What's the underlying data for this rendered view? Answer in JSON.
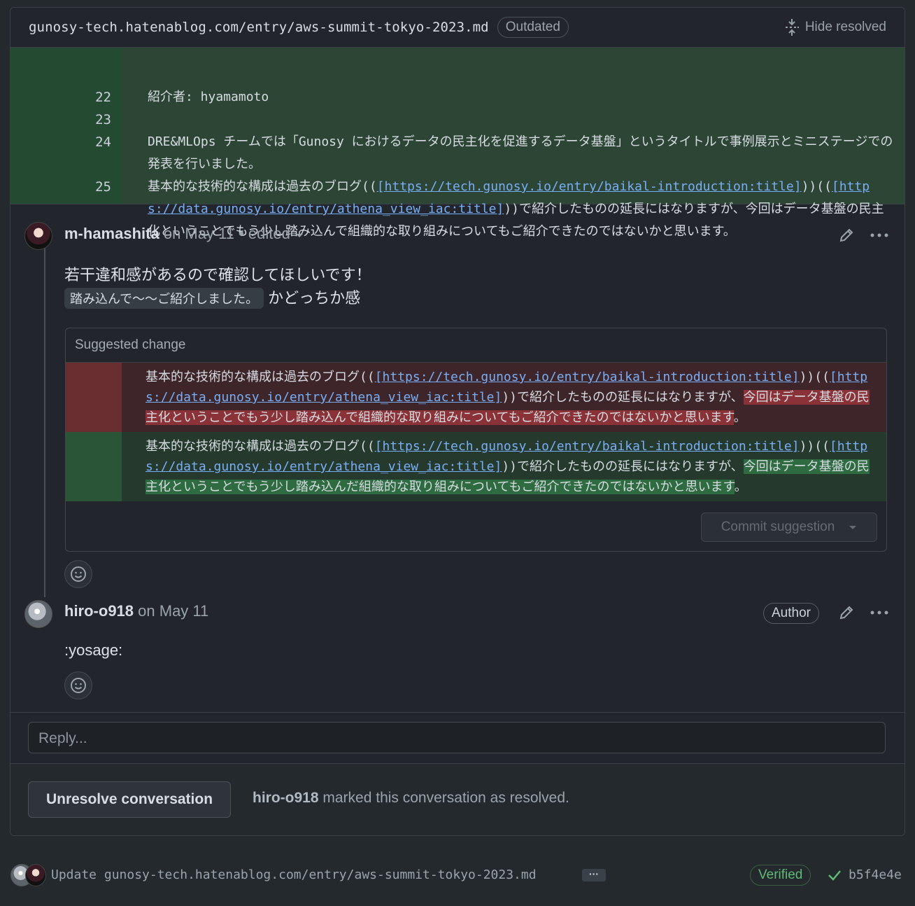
{
  "thread": {
    "file_path": "gunosy-tech.hatenablog.com/entry/aws-summit-tokyo-2023.md",
    "outdated_label": "Outdated",
    "hide_resolved_label": "Hide resolved"
  },
  "diff": {
    "lines": [
      {
        "no": "22",
        "text": "紹介者: hyamamoto"
      },
      {
        "no": "23",
        "text": ""
      },
      {
        "no": "24",
        "text": "DRE&MLOps チームでは「Gunosy におけるデータの民主化を促進するデータ基盤」というタイトルで事例展示とミニステージでの発表を行いました。"
      },
      {
        "no": "25",
        "prefix": "基本的な技術的な構成は過去のブログ((",
        "link1": "[https://tech.gunosy.io/entry/baikal-introduction:title]",
        "mid": "))((",
        "link2": "[https://data.gunosy.io/entry/athena_view_iac:title]",
        "suffix": "))で紹介したものの延長にはなりますが、今回はデータ基盤の民主化ということでもう少し踏み込んで組織的な取り組みについてもご紹介できたのではないかと思います。"
      }
    ]
  },
  "comment1": {
    "author": "m-hamashita",
    "date": "on May 11",
    "edited": "• edited",
    "line1": "若干違和感があるので確認してほしいです！",
    "code": "踏み込んで～～ご紹介しました。",
    "line2": "かどっちか感",
    "suggestion_title": "Suggested change",
    "del_prefix": "基本的な技術的な構成は過去のブログ((",
    "del_link1": "[https://tech.gunosy.io/entry/baikal-introduction:title]",
    "del_mid": "))((",
    "del_link2": "[https://data.gunosy.io/entry/athena_view_iac:title]",
    "del_suffix": "))で紹介したものの延長にはなりますが、",
    "del_highlight": "今回はデータ基盤の民主化ということでもう少し踏み込んで組織的な取り組みについてもご紹介できたのではないかと思います",
    "del_end": "。",
    "add_prefix": "基本的な技術的な構成は過去のブログ((",
    "add_link1": "[https://tech.gunosy.io/entry/baikal-introduction:title]",
    "add_mid": "))((",
    "add_link2": "[https://data.gunosy.io/entry/athena_view_iac:title]",
    "add_suffix": "))で紹介したものの延長にはなりますが、",
    "add_highlight": "今回はデータ基盤の民主化ということでもう少し踏み込んだ組織的な取り組みについてもご紹介できたのではないかと思います",
    "add_end": "。",
    "commit_label": "Commit suggestion"
  },
  "comment2": {
    "author": "hiro-o918",
    "date": "on May 11",
    "badge": "Author",
    "text": ":yosage:"
  },
  "reply": {
    "placeholder": "Reply..."
  },
  "resolve": {
    "button": "Unresolve conversation",
    "user": "hiro-o918",
    "message": "marked this conversation as resolved."
  },
  "commit": {
    "message": "Update gunosy-tech.hatenablog.com/entry/aws-summit-tokyo-2023.md",
    "ellipsis": "···",
    "verified": "Verified",
    "sha": "b5f4e4e"
  }
}
